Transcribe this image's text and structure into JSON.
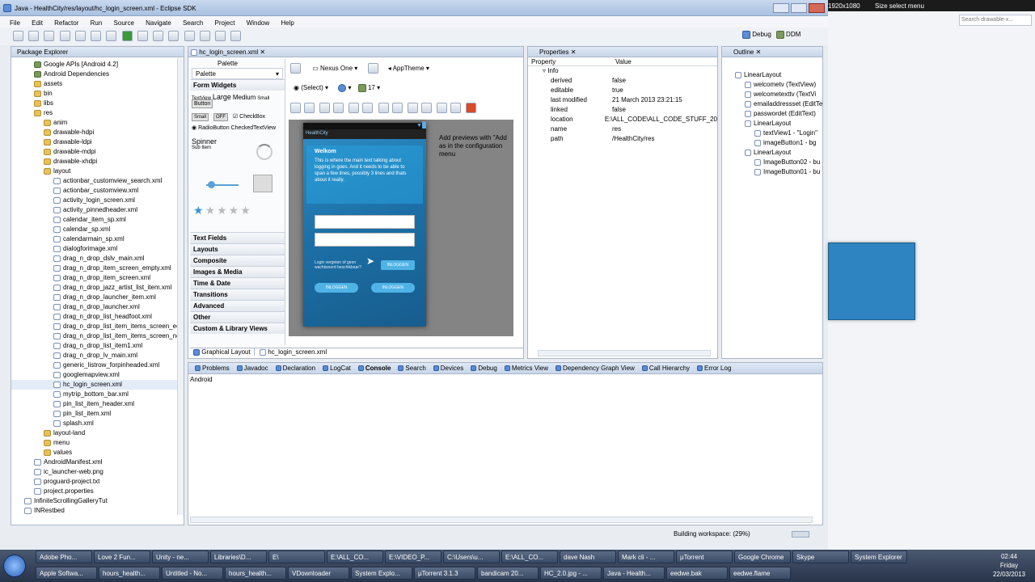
{
  "window": {
    "title": "Java - HealthCity/res/layout/hc_login_screen.xml - Eclipse SDK"
  },
  "menu": [
    "File",
    "Edit",
    "Refactor",
    "Run",
    "Source",
    "Navigate",
    "Search",
    "Project",
    "Window",
    "Help"
  ],
  "perspectives": {
    "debug": "Debug",
    "ddms": "DDM"
  },
  "pkg_explorer": {
    "tab": "Package Explorer",
    "items": [
      "Google APIs [Android 4.2]",
      "Android Dependencies",
      "assets",
      "bin",
      "libs",
      "res",
      "anim",
      "drawable-hdpi",
      "drawable-ldpi",
      "drawable-mdpi",
      "drawable-xhdpi",
      "layout",
      "actionbar_customview_search.xml",
      "actionbar_customview.xml",
      "activity_login_screen.xml",
      "activity_pinnedheader.xml",
      "calendar_item_sp.xml",
      "calendar_sp.xml",
      "calendarmain_sp.xml",
      "dialogforimage.xml",
      "drag_n_drop_dslv_main.xml",
      "drag_n_drop_item_screen_empty.xml",
      "drag_n_drop_item_screen.xml",
      "drag_n_drop_jazz_artist_list_item.xml",
      "drag_n_drop_launcher_item.xml",
      "drag_n_drop_launcher.xml",
      "drag_n_drop_list_headfoot.xml",
      "drag_n_drop_list_item_items_screen_ec",
      "drag_n_drop_list_item_items_screen_nc",
      "drag_n_drop_list_item1.xml",
      "drag_n_drop_lv_main.xml",
      "generic_listrow_forpinheaded.xml",
      "googlemapview.xml",
      "hc_login_screen.xml",
      "mytrip_bottom_bar.xml",
      "pin_list_item_header.xml",
      "pin_list_item.xml",
      "splash.xml",
      "layout-land",
      "menu",
      "values",
      "AndroidManifest.xml",
      "ic_launcher-web.png",
      "proguard-project.txt",
      "project.properties",
      "InfiniteScrollingGalleryTut",
      "INRestbed"
    ]
  },
  "editor": {
    "tab": "hc_login_screen.xml",
    "palette_title": "Palette",
    "palette_dropdown": "Palette",
    "form_widgets": "Form Widgets",
    "widget_text": {
      "textview": "TextView",
      "large": "Large",
      "medium": "Medium",
      "small": "Small",
      "button": "Button",
      "small_btn": "Small",
      "off": "OFF",
      "checkbox": "CheckBox",
      "radio": "RadioButton",
      "checked_tv": "CheckedTextView",
      "spinner": "Spinner",
      "sub_item": "Sub Item"
    },
    "categories": [
      "Text Fields",
      "Layouts",
      "Composite",
      "Images & Media",
      "Time & Date",
      "Transitions",
      "Advanced",
      "Other",
      "Custom & Library Views"
    ],
    "device": "Nexus One",
    "theme": "AppTheme",
    "select": "(Select)",
    "api": "17",
    "bottom_tabs": [
      "Graphical Layout",
      "hc_login_screen.xml"
    ],
    "hint": "Add previews with \"Add as in the configuration menu"
  },
  "phone": {
    "app": "HealthCity",
    "welcome": "Welkom",
    "body": "This is where the main text talking about logging in goes. And it needs to be able to span a few lines, possibly 3 lines and thats about it really.",
    "forgot": "Login vergeten of geen wachtwoord beschikbaar?",
    "btn": "INLOGGEN"
  },
  "properties": {
    "tab": "Properties",
    "col_property": "Property",
    "col_value": "Value",
    "group": "Info",
    "rows": [
      {
        "k": "derived",
        "v": "false"
      },
      {
        "k": "editable",
        "v": "true"
      },
      {
        "k": "last modified",
        "v": "21 March 2013 23:21:15"
      },
      {
        "k": "linked",
        "v": "false"
      },
      {
        "k": "location",
        "v": "E:\\ALL_CODE\\ALL_CODE_STUFF_20"
      },
      {
        "k": "name",
        "v": "res"
      },
      {
        "k": "path",
        "v": "/HealthCity/res"
      }
    ]
  },
  "outline": {
    "tab": "Outline",
    "items": [
      "LinearLayout",
      "welcometv (TextView)",
      "welcometexttv (TextVi",
      "emailaddressset (EditTe",
      "passwordet (EditText)",
      "LinearLayout",
      "textView1 - \"Login\"",
      "imageButton1 - bg",
      "LinearLayout",
      "ImageButton02 - bu",
      "ImageButton01 - bu"
    ]
  },
  "console": {
    "tabs": [
      "Problems",
      "Javadoc",
      "Declaration",
      "LogCat",
      "Console",
      "Search",
      "Devices",
      "Debug",
      "Metrics View",
      "Dependency Graph View",
      "Call Hierarchy",
      "Error Log"
    ],
    "text": "Android"
  },
  "status": {
    "building": "Building workspace: (29%)"
  },
  "right_bar": {
    "resolution": "1920x1080",
    "size_menu": "Size select menu",
    "search": "Search drawable-x..."
  },
  "taskbar": {
    "row1": [
      "Adobe Pho...",
      "Love 2 Fun...",
      "Unity - ne...",
      "Libraries\\D...",
      "E\\",
      "E:\\ALL_CO...",
      "E:\\VIDEO_P...",
      "C:\\Users\\u...",
      "E:\\ALL_CO...",
      "dave Nash",
      "Mark cli - ...",
      "µTorrent",
      "Google Chrome",
      "Skype",
      "System Explorer"
    ],
    "row2": [
      "Apple Softwa...",
      "hours_health...",
      "Untitled - No...",
      "hours_health...",
      "VDownloader",
      "System Explo...",
      "µTorrent 3.1.3",
      "bandicam 20...",
      "HC_2.0.jpg - ...",
      "Java - Health...",
      "eedwe.bak",
      "eedwe.flame"
    ],
    "clock": {
      "time": "02:44",
      "day": "Friday",
      "date": "22/03/2013"
    }
  }
}
